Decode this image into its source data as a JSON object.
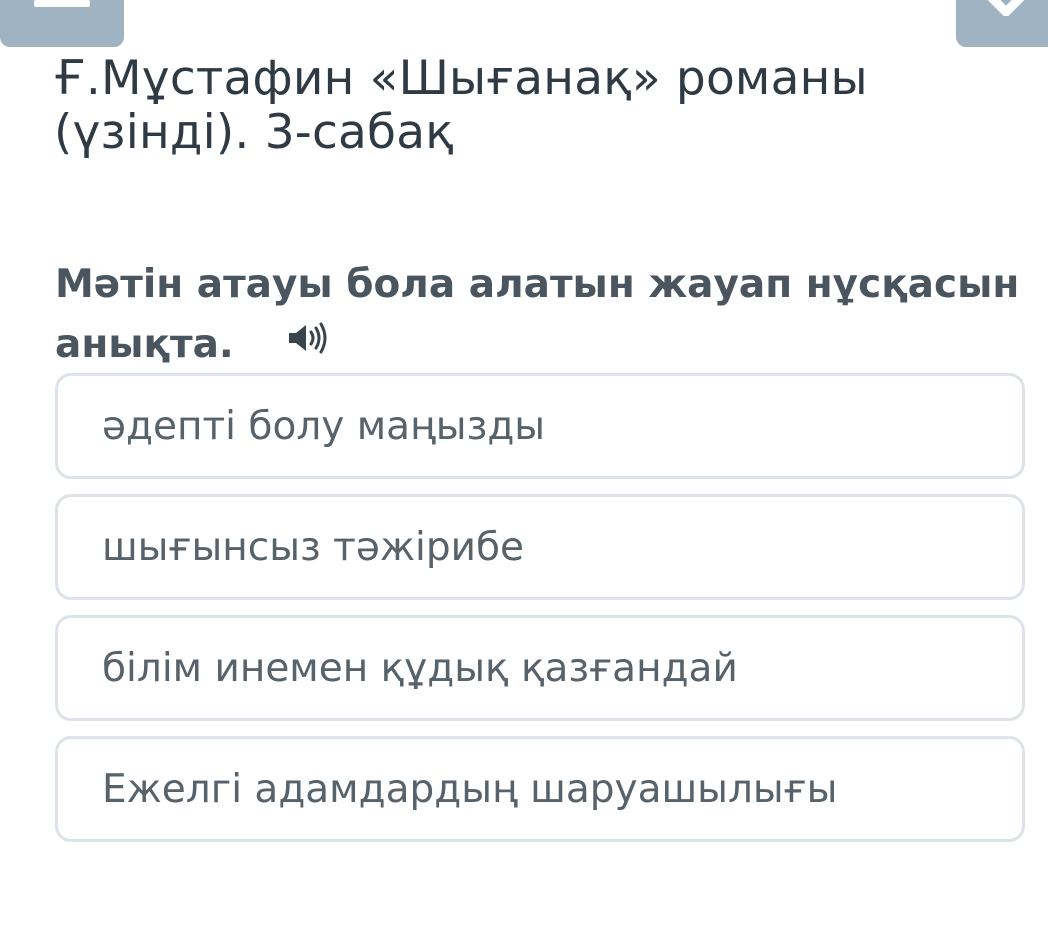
{
  "header": {
    "menu_icon": "menu-icon",
    "close_icon": "close-icon"
  },
  "lesson": {
    "title_line1": "Ғ.Мұстафин «Шығанақ» романы",
    "title_line2": "(үзінді). 3-сабақ"
  },
  "question": {
    "text": "Мәтін атауы бола алатын жауап нұсқасын анықта.",
    "audio_icon": "speaker-icon"
  },
  "options": [
    {
      "label": "әдепті болу маңызды"
    },
    {
      "label": "шығынсыз тәжірибе"
    },
    {
      "label": "білім инемен құдық қазғандай"
    },
    {
      "label": "Ежелгі адамдардың шаруашылығы"
    }
  ],
  "colors": {
    "header_button": "#9fb3c3",
    "title_text": "#2f3a44",
    "question_text": "#4a5560",
    "option_text": "#58626b",
    "option_border": "#dde3e8"
  }
}
